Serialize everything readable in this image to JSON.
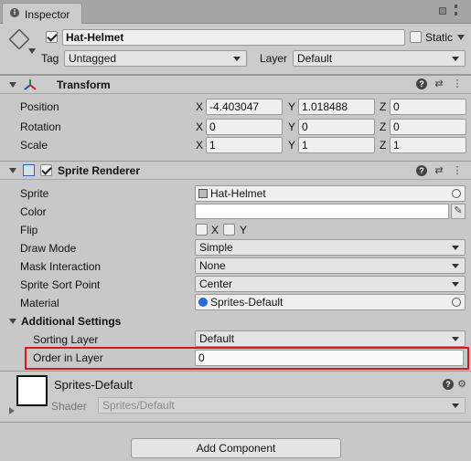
{
  "tab": {
    "label": "Inspector"
  },
  "gameobject": {
    "name": "Hat-Helmet",
    "static_label": "Static",
    "tag_label": "Tag",
    "tag_value": "Untagged",
    "layer_label": "Layer",
    "layer_value": "Default"
  },
  "transform": {
    "title": "Transform",
    "position": {
      "label": "Position",
      "x": "-4.403047",
      "y": "1.018488",
      "z": "0"
    },
    "rotation": {
      "label": "Rotation",
      "x": "0",
      "y": "0",
      "z": "0"
    },
    "scale": {
      "label": "Scale",
      "x": "1",
      "y": "1",
      "z": "1"
    }
  },
  "axis": {
    "x": "X",
    "y": "Y",
    "z": "Z"
  },
  "sprite_renderer": {
    "title": "Sprite Renderer",
    "sprite_label": "Sprite",
    "sprite_value": "Hat-Helmet",
    "color_label": "Color",
    "flip_label": "Flip",
    "flip_x": "X",
    "flip_y": "Y",
    "draw_mode_label": "Draw Mode",
    "draw_mode_value": "Simple",
    "mask_label": "Mask Interaction",
    "mask_value": "None",
    "sort_point_label": "Sprite Sort Point",
    "sort_point_value": "Center",
    "material_label": "Material",
    "material_value": "Sprites-Default",
    "additional_label": "Additional Settings",
    "sorting_layer_label": "Sorting Layer",
    "sorting_layer_value": "Default",
    "order_label": "Order in Layer",
    "order_value": "0"
  },
  "material": {
    "name": "Sprites-Default",
    "shader_label": "Shader",
    "shader_value": "Sprites/Default"
  },
  "add_component": {
    "label": "Add Component"
  },
  "colors": {
    "highlight": "#e0161b",
    "panel": "#c8c8c8"
  }
}
